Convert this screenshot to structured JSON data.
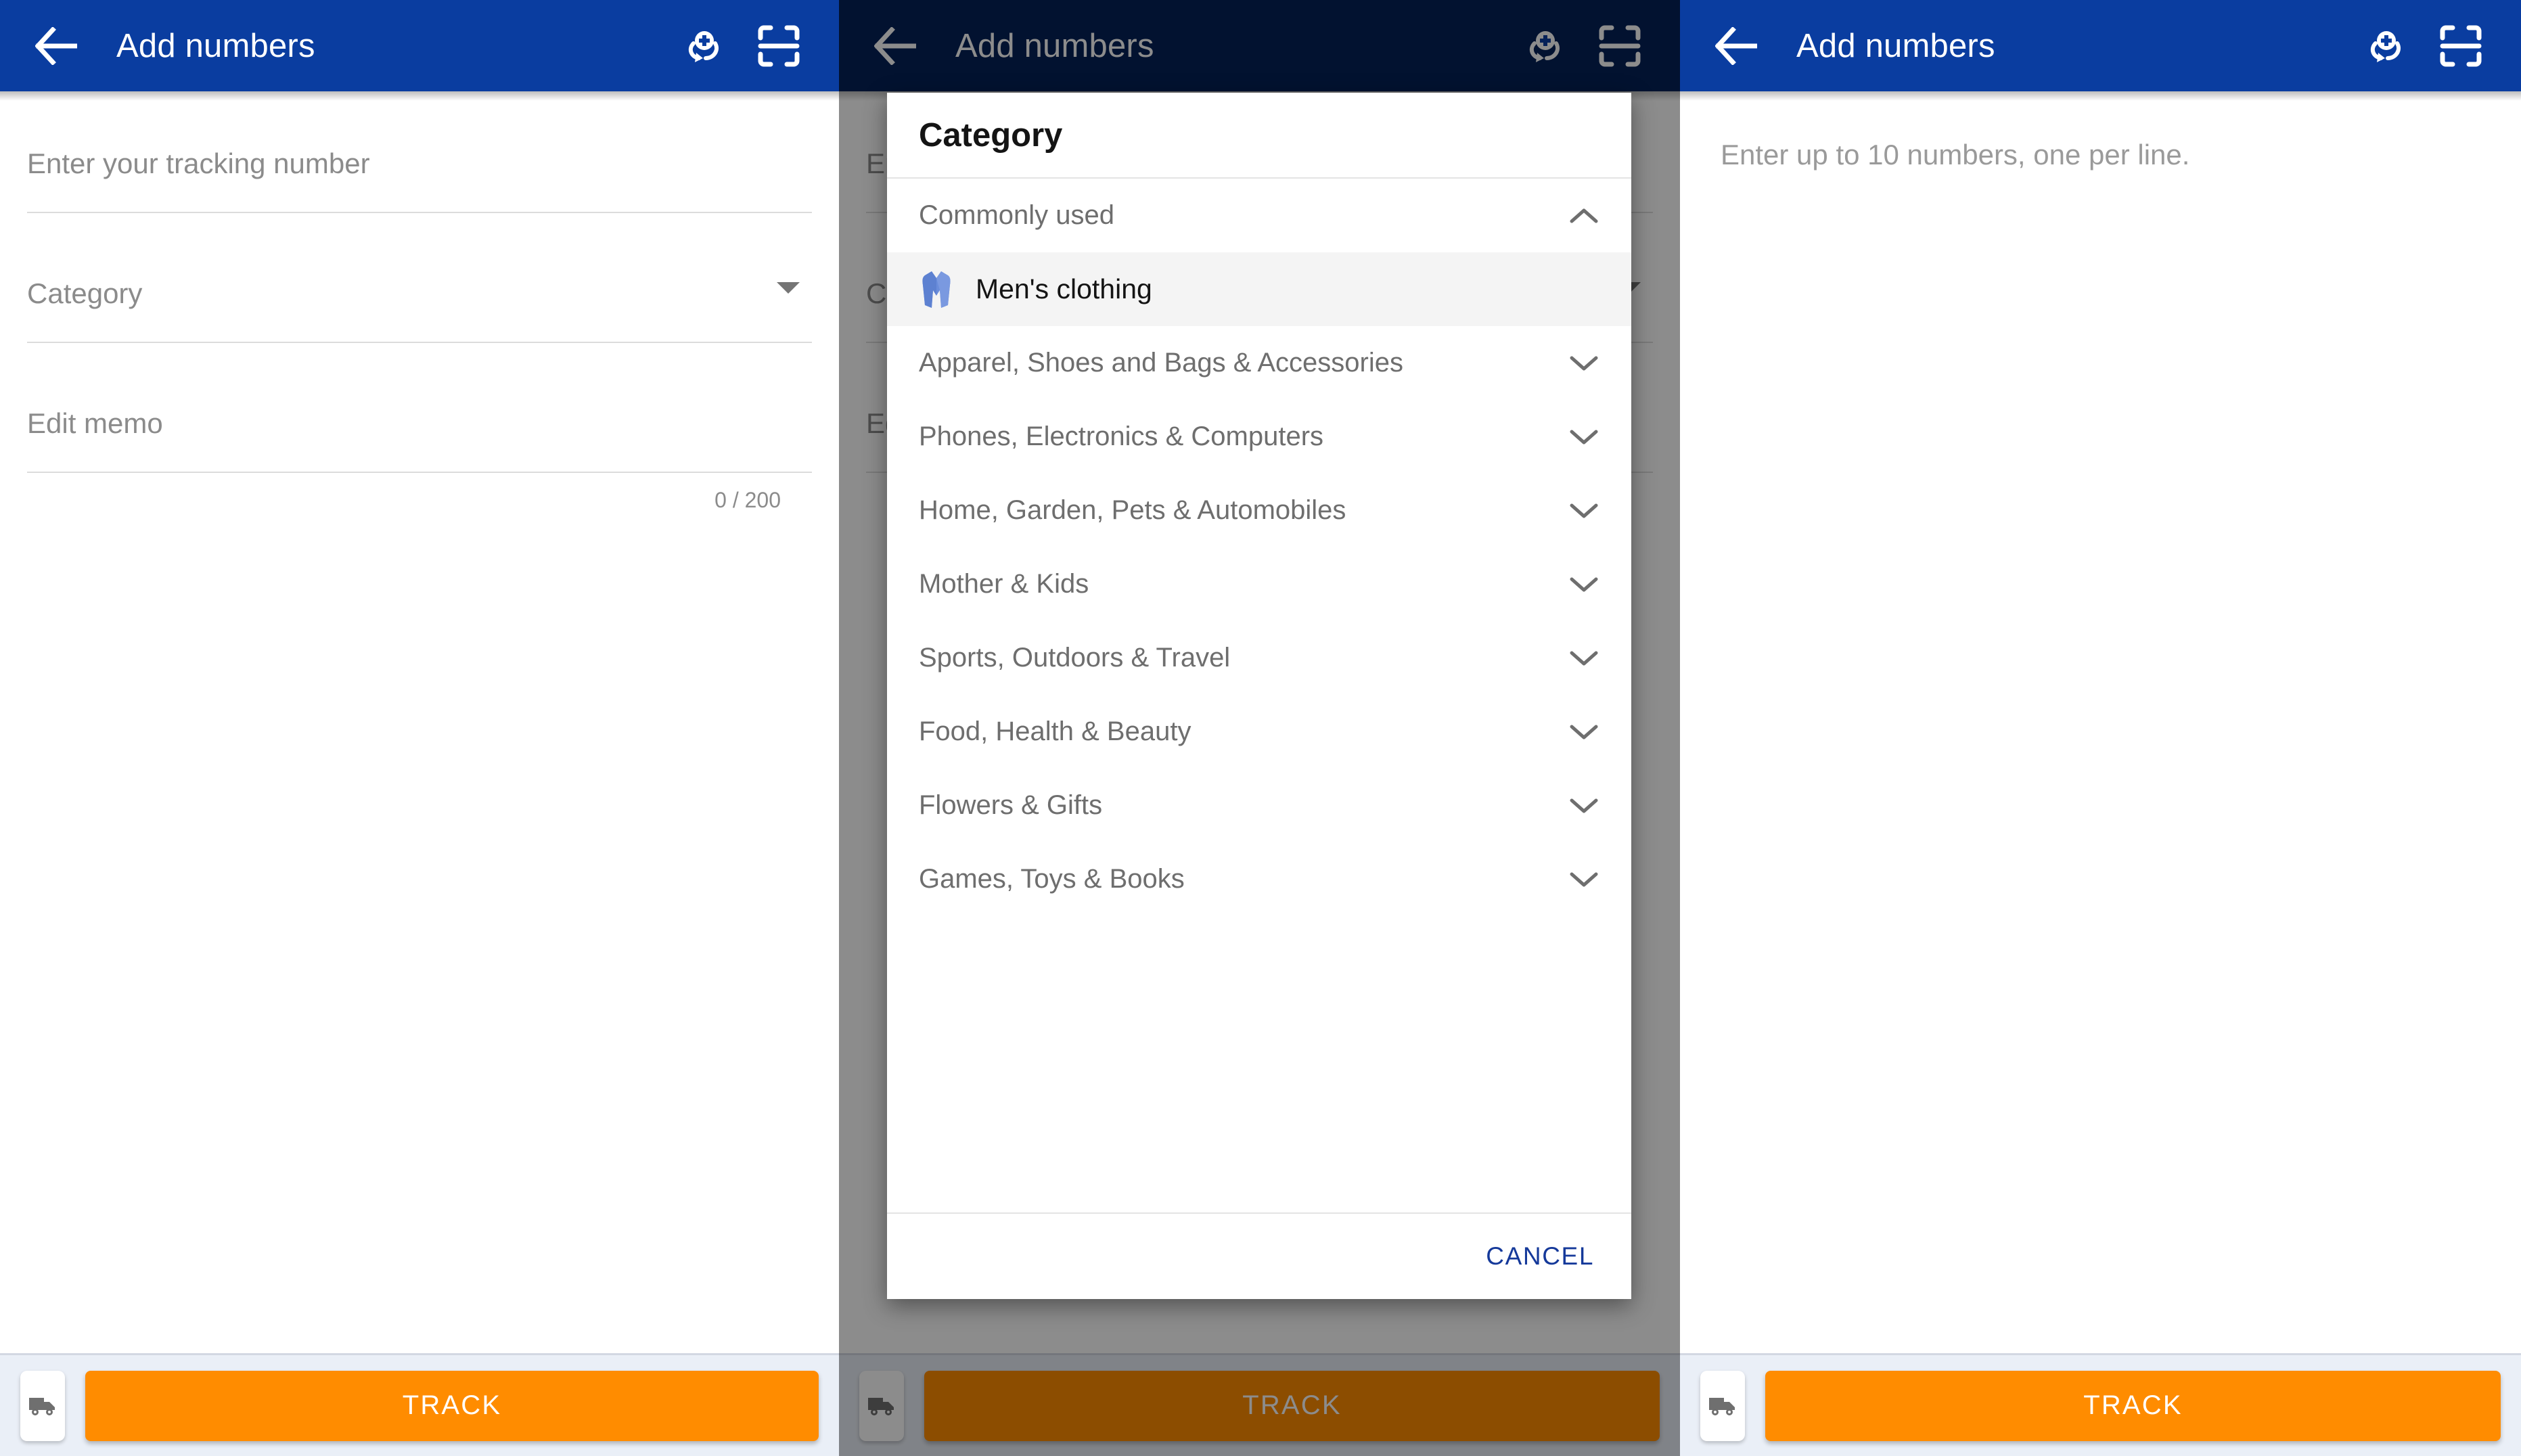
{
  "app": {
    "title": "Add numbers",
    "header_color": "#0a3da0",
    "accent_orange": "#ff8c00",
    "link_blue": "#15399a"
  },
  "appbar": {
    "back_icon": "arrow-left-icon",
    "batch_add_icon": "batch-add-icon",
    "scan_icon": "barcode-scan-icon"
  },
  "panel1": {
    "fields": {
      "tracking_placeholder": "Enter your tracking number",
      "category_placeholder": "Category",
      "memo_placeholder": "Edit memo",
      "memo_counter": "0 / 200"
    }
  },
  "panel3": {
    "multiline_hint": "Enter up to 10 numbers, one per line."
  },
  "bottombar": {
    "track_label": "TRACK",
    "carrier_icon": "delivery-truck-icon"
  },
  "dialog": {
    "title": "Category",
    "cancel_label": "CANCEL",
    "section": {
      "label": "Commonly used",
      "expanded": true,
      "chevron": "chevron-up-icon",
      "items": [
        {
          "label": "Men's clothing",
          "emoji": "coat-icon",
          "selected": true
        }
      ]
    },
    "groups": [
      {
        "label": "Apparel, Shoes and Bags & Accessories",
        "chevron": "chevron-down-icon"
      },
      {
        "label": "Phones, Electronics & Computers",
        "chevron": "chevron-down-icon"
      },
      {
        "label": "Home, Garden, Pets & Automobiles",
        "chevron": "chevron-down-icon"
      },
      {
        "label": "Mother & Kids",
        "chevron": "chevron-down-icon"
      },
      {
        "label": "Sports, Outdoors & Travel",
        "chevron": "chevron-down-icon"
      },
      {
        "label": "Food, Health & Beauty",
        "chevron": "chevron-down-icon"
      },
      {
        "label": "Flowers & Gifts",
        "chevron": "chevron-down-icon"
      },
      {
        "label": "Games, Toys & Books",
        "chevron": "chevron-down-icon"
      }
    ]
  }
}
